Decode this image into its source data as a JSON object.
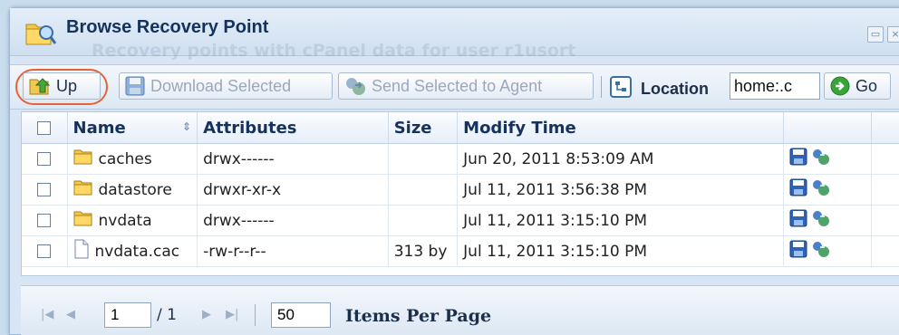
{
  "window": {
    "title": "Browse Recovery Point",
    "ghost_text": "Recovery points with cPanel data for user r1usort"
  },
  "toolbar": {
    "up_label": "Up",
    "download_label": "Download Selected",
    "send_label": "Send Selected to Agent",
    "location_label": "Location",
    "location_value": "home:.c",
    "go_label": "Go"
  },
  "table": {
    "columns": [
      "Name",
      "Attributes",
      "Size",
      "Modify Time"
    ],
    "rows": [
      {
        "name": "caches",
        "type": "folder",
        "attributes": "drwx------",
        "size": "",
        "modified": "Jun 20, 2011 8:53:09 AM"
      },
      {
        "name": "datastore",
        "type": "folder",
        "attributes": "drwxr-xr-x",
        "size": "",
        "modified": "Jul 11, 2011 3:56:38 PM"
      },
      {
        "name": "nvdata",
        "type": "folder",
        "attributes": "drwx------",
        "size": "",
        "modified": "Jul 11, 2011 3:15:10 PM"
      },
      {
        "name": "nvdata.cac",
        "type": "file",
        "attributes": "-rw-r--r--",
        "size": "313 by",
        "modified": "Jul 11, 2011 3:15:10 PM"
      }
    ]
  },
  "pager": {
    "page": "1",
    "of_pages": "/ 1",
    "per_page": "50",
    "per_page_label": "Items Per Page"
  },
  "icons": {
    "folder": "folder-icon",
    "file": "file-icon",
    "save": "save-icon",
    "send": "send-to-agent-icon"
  },
  "colors": {
    "highlight": "#e2633a",
    "title_text": "#15325e",
    "go_green": "#3aa43a"
  }
}
